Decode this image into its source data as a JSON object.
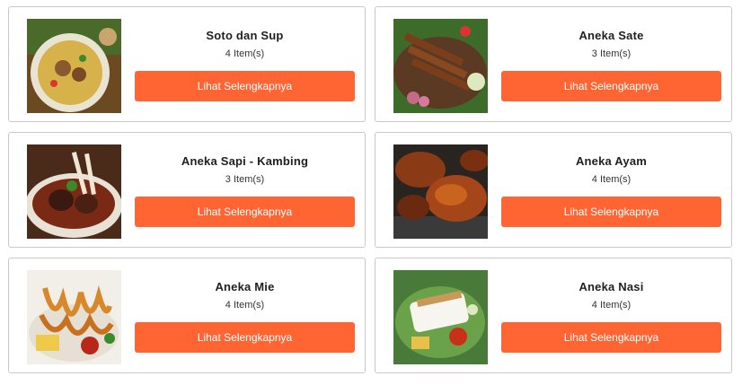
{
  "categories": [
    {
      "title": "Soto dan Sup",
      "count": "4 Item(s)",
      "button": "Lihat Selengkapnya",
      "image": "soto-soup-image"
    },
    {
      "title": "Aneka Sate",
      "count": "3 Item(s)",
      "button": "Lihat Selengkapnya",
      "image": "satay-image"
    },
    {
      "title": "Aneka Sapi - Kambing",
      "count": "3 Item(s)",
      "button": "Lihat Selengkapnya",
      "image": "beef-goat-image"
    },
    {
      "title": "Aneka Ayam",
      "count": "4 Item(s)",
      "button": "Lihat Selengkapnya",
      "image": "grilled-chicken-image"
    },
    {
      "title": "Aneka Mie",
      "count": "4 Item(s)",
      "button": "Lihat Selengkapnya",
      "image": "noodles-image"
    },
    {
      "title": "Aneka Nasi",
      "count": "4 Item(s)",
      "button": "Lihat Selengkapnya",
      "image": "rice-image"
    }
  ],
  "colors": {
    "button": "#ff6433",
    "border": "#c9c9c9"
  }
}
